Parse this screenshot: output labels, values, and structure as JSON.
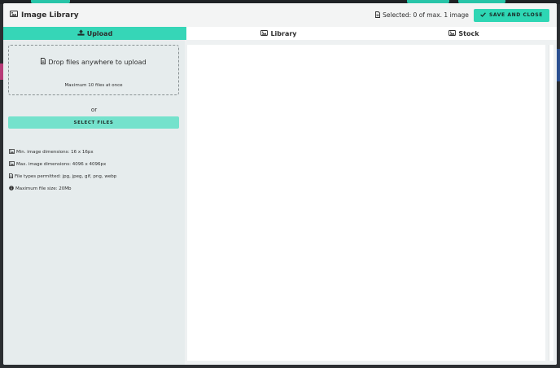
{
  "header": {
    "title": "Image Library",
    "selected_text": "Selected: 0 of max. 1 image",
    "save_label": "SAVE AND CLOSE"
  },
  "tabs": [
    {
      "label": "Upload",
      "icon": "upload-icon",
      "active": true
    },
    {
      "label": "Library",
      "icon": "image-icon",
      "active": false
    },
    {
      "label": "Stock",
      "icon": "image-icon",
      "active": false
    }
  ],
  "upload": {
    "drop_title": "Drop files anywhere to upload",
    "drop_sub": "Maximum 10 files at once",
    "or_text": "or",
    "select_label": "SELECT FILES",
    "info": [
      {
        "icon": "image-icon",
        "text": "Min. image dimensions: 16 x 16px"
      },
      {
        "icon": "image-icon",
        "text": "Max. image dimensions: 4096 x 4096px"
      },
      {
        "icon": "file-icon",
        "text": "File types permitted: jpg, jpeg, gif, png, webp"
      },
      {
        "icon": "info-icon",
        "text": "Maximum file size: 20Mb"
      }
    ]
  },
  "colors": {
    "accent": "#36d6b7",
    "accent_light": "#74e2cc",
    "panel_bg": "#e6eced"
  }
}
